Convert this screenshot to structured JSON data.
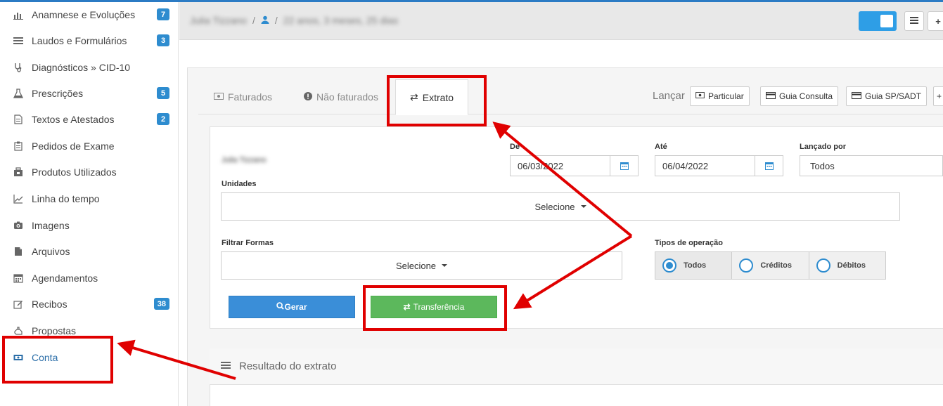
{
  "sidebar": {
    "items": [
      {
        "label": "Anamnese e Evoluções",
        "icon": "bar-chart-icon",
        "badge": "7"
      },
      {
        "label": "Laudos e Formulários",
        "icon": "list-icon",
        "badge": "3"
      },
      {
        "label": "Diagnósticos » CID-10",
        "icon": "stethoscope-icon",
        "badge": ""
      },
      {
        "label": "Prescrições",
        "icon": "flask-icon",
        "badge": "5"
      },
      {
        "label": "Textos e Atestados",
        "icon": "file-text-icon",
        "badge": "2"
      },
      {
        "label": "Pedidos de Exame",
        "icon": "clipboard-icon",
        "badge": ""
      },
      {
        "label": "Produtos Utilizados",
        "icon": "box-icon",
        "badge": ""
      },
      {
        "label": "Linha do tempo",
        "icon": "line-chart-icon",
        "badge": ""
      },
      {
        "label": "Imagens",
        "icon": "camera-icon",
        "badge": ""
      },
      {
        "label": "Arquivos",
        "icon": "file-icon",
        "badge": ""
      },
      {
        "label": "Agendamentos",
        "icon": "calendar-icon",
        "badge": ""
      },
      {
        "label": "Recibos",
        "icon": "edit-icon",
        "badge": "38"
      },
      {
        "label": "Propostas",
        "icon": "hand-icon",
        "badge": ""
      },
      {
        "label": "Conta",
        "icon": "money-icon",
        "badge": ""
      }
    ]
  },
  "header": {
    "patient_name": "Julia Tizzano",
    "separator": "/",
    "age": "22 anos, 3 meses, 25 dias"
  },
  "tabs": {
    "faturados": "Faturados",
    "nao_faturados": "Não faturados",
    "extrato": "Extrato"
  },
  "lancar": {
    "label": "Lançar",
    "particular": "Particular",
    "guia_consulta": "Guia Consulta",
    "guia_sp_sadt": "Guia SP/SADT"
  },
  "filters": {
    "patient_name_blurred": "Julia Tizzano",
    "de_label": "De",
    "de_value": "06/03/2022",
    "ate_label": "Até",
    "ate_value": "06/04/2022",
    "lancado_por_label": "Lançado por",
    "lancado_por_value": "Todos",
    "unidades_label": "Unidades",
    "unidades_value": "Selecione",
    "filtrar_formas_label": "Filtrar Formas",
    "filtrar_formas_value": "Selecione",
    "tipos_label": "Tipos de operação",
    "tipos_options": [
      "Todos",
      "Créditos",
      "Débitos"
    ],
    "tipos_selected": "Todos"
  },
  "actions": {
    "gerar": "Gerar",
    "transferencia": "Transferência"
  },
  "result": {
    "title": "Resultado do extrato"
  },
  "colors": {
    "accent": "#2e8ccf",
    "primary_button": "#3a8ed8",
    "success_button": "#5cb85c",
    "annotation_red": "#e00000"
  }
}
